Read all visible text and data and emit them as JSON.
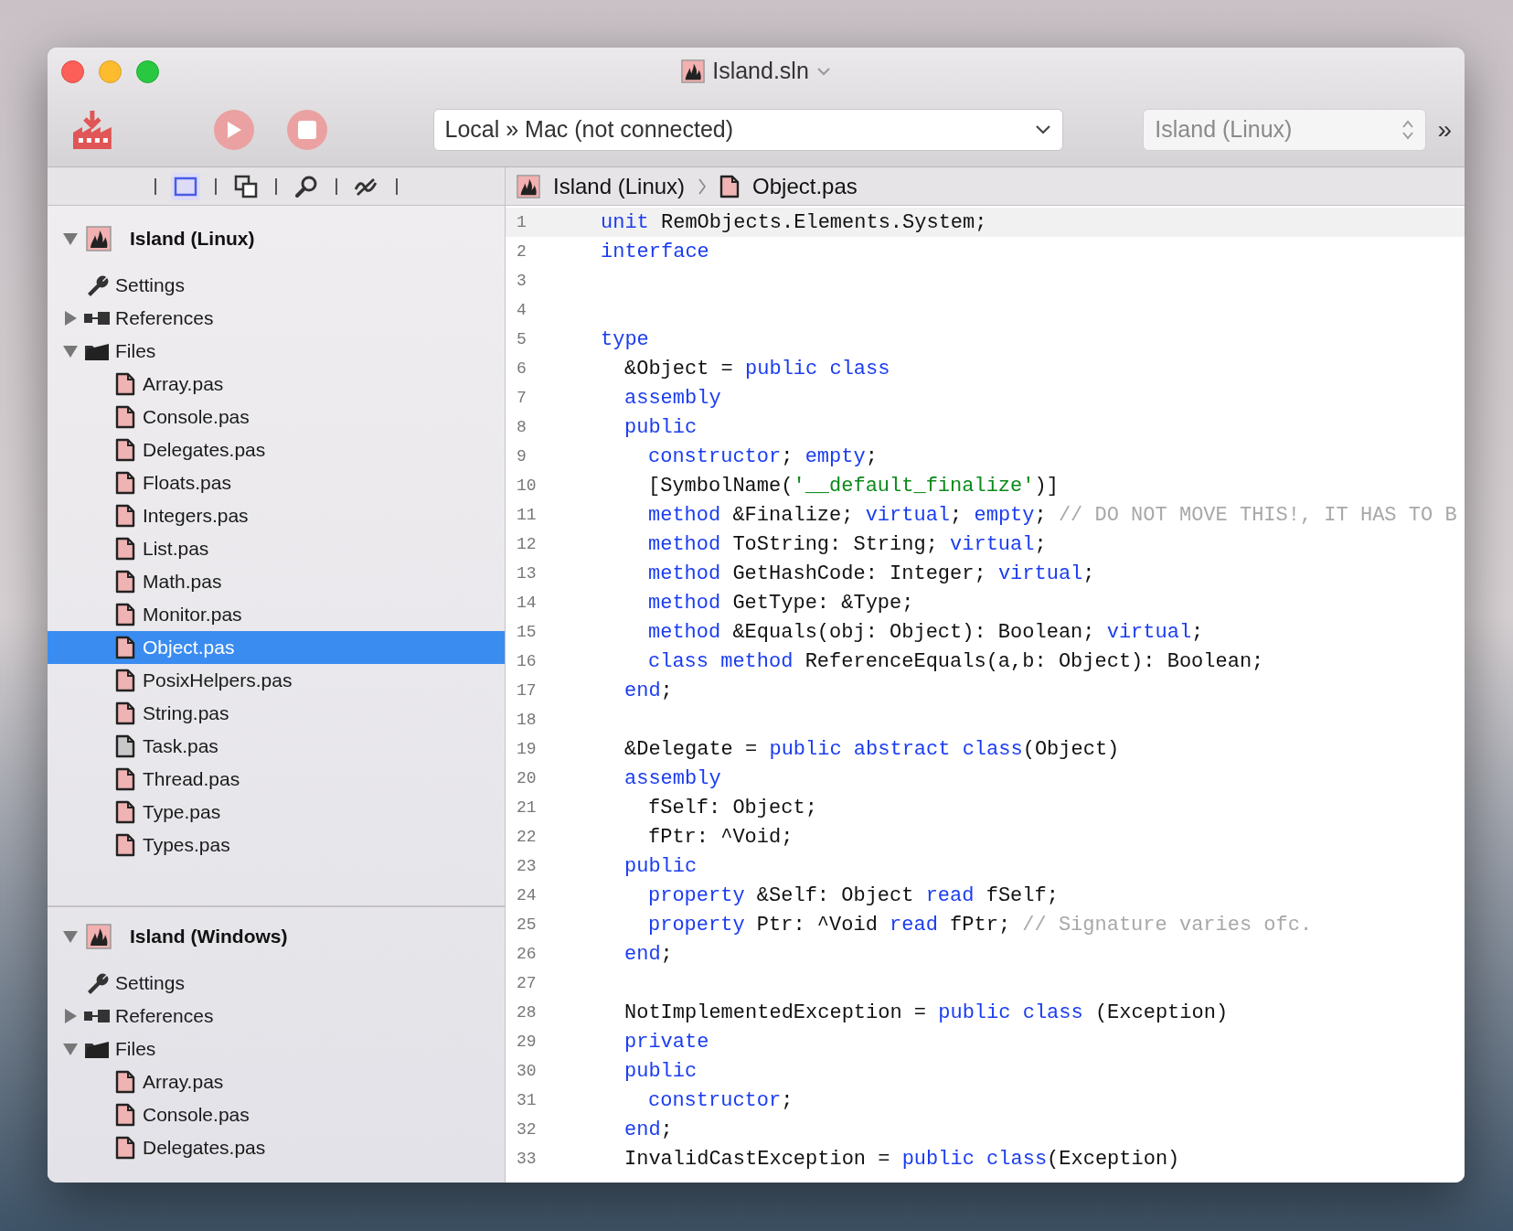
{
  "window": {
    "title": "Island.sln"
  },
  "toolbar": {
    "play_disabled": true,
    "stop_disabled": true,
    "device": "Local » Mac (not connected)",
    "target": "Island (Linux)",
    "overflow": "»"
  },
  "breadcrumb": [
    "Island (Linux)",
    "Object.pas"
  ],
  "sidebar": {
    "tabs": [
      {
        "kind": "project",
        "selected": true
      },
      {
        "kind": "copy",
        "selected": false
      },
      {
        "kind": "search",
        "selected": false
      },
      {
        "kind": "diff",
        "selected": false
      }
    ],
    "projects": [
      {
        "name": "Island (Linux)",
        "expanded": true,
        "items": [
          {
            "kind": "settings",
            "label": "Settings",
            "selected": false
          },
          {
            "kind": "references",
            "label": "References",
            "expanded": false,
            "selected": false
          },
          {
            "kind": "folder",
            "label": "Files",
            "expanded": true,
            "selected": false,
            "children": [
              {
                "kind": "file",
                "label": "Array.pas",
                "color": "#efb3b3",
                "selected": false
              },
              {
                "kind": "file",
                "label": "Console.pas",
                "color": "#efb3b3",
                "selected": false
              },
              {
                "kind": "file",
                "label": "Delegates.pas",
                "color": "#efb3b3",
                "selected": false
              },
              {
                "kind": "file",
                "label": "Floats.pas",
                "color": "#efb3b3",
                "selected": false
              },
              {
                "kind": "file",
                "label": "Integers.pas",
                "color": "#efb3b3",
                "selected": false
              },
              {
                "kind": "file",
                "label": "List.pas",
                "color": "#efb3b3",
                "selected": false
              },
              {
                "kind": "file",
                "label": "Math.pas",
                "color": "#efb3b3",
                "selected": false
              },
              {
                "kind": "file",
                "label": "Monitor.pas",
                "color": "#efb3b3",
                "selected": false
              },
              {
                "kind": "file",
                "label": "Object.pas",
                "color": "#efb3b3",
                "selected": true
              },
              {
                "kind": "file",
                "label": "PosixHelpers.pas",
                "color": "#efb3b3",
                "selected": false
              },
              {
                "kind": "file",
                "label": "String.pas",
                "color": "#efb3b3",
                "selected": false
              },
              {
                "kind": "file",
                "label": "Task.pas",
                "color": "#c8c8c8",
                "selected": false
              },
              {
                "kind": "file",
                "label": "Thread.pas",
                "color": "#efb3b3",
                "selected": false
              },
              {
                "kind": "file",
                "label": "Type.pas",
                "color": "#efb3b3",
                "selected": false
              },
              {
                "kind": "file",
                "label": "Types.pas",
                "color": "#efb3b3",
                "selected": false
              }
            ]
          }
        ]
      },
      {
        "name": "Island (Windows)",
        "expanded": true,
        "items": [
          {
            "kind": "settings",
            "label": "Settings",
            "selected": false
          },
          {
            "kind": "references",
            "label": "References",
            "expanded": false,
            "selected": false
          },
          {
            "kind": "folder",
            "label": "Files",
            "expanded": true,
            "selected": false,
            "children": [
              {
                "kind": "file",
                "label": "Array.pas",
                "color": "#efb3b3",
                "selected": false
              },
              {
                "kind": "file",
                "label": "Console.pas",
                "color": "#efb3b3",
                "selected": false
              },
              {
                "kind": "file",
                "label": "Delegates.pas",
                "color": "#efb3b3",
                "selected": false
              }
            ]
          }
        ]
      }
    ]
  },
  "editor": {
    "lines": [
      {
        "number": "1",
        "current": true,
        "kind": "section",
        "tokens": [
          {
            "kind": "keyword",
            "text": "unit"
          },
          {
            "kind": "plain",
            "text": " RemObjects.Elements.System;"
          }
        ]
      },
      {
        "number": "2",
        "current": false,
        "kind": "section",
        "tokens": [
          {
            "kind": "keyword",
            "text": "interface"
          }
        ]
      },
      {
        "number": "3",
        "current": false,
        "kind": "blank"
      },
      {
        "number": "4",
        "current": false,
        "kind": "blank"
      },
      {
        "number": "5",
        "current": false,
        "kind": "section",
        "tokens": [
          {
            "kind": "keyword",
            "text": "type"
          }
        ]
      },
      {
        "number": "6",
        "current": false,
        "kind": "declaration",
        "tokens": [
          {
            "kind": "plain",
            "text": "&Object = "
          },
          {
            "kind": "keyword",
            "text": "public class"
          }
        ]
      },
      {
        "number": "7",
        "current": false,
        "kind": "declaration",
        "tokens": [
          {
            "kind": "keyword",
            "text": "assembly"
          }
        ]
      },
      {
        "number": "8",
        "current": false,
        "kind": "declaration",
        "tokens": [
          {
            "kind": "keyword",
            "text": "public"
          }
        ]
      },
      {
        "number": "9",
        "current": false,
        "kind": "member",
        "tokens": [
          {
            "kind": "keyword",
            "text": "constructor"
          },
          {
            "kind": "plain",
            "text": "; "
          },
          {
            "kind": "keyword",
            "text": "empty"
          },
          {
            "kind": "plain",
            "text": ";"
          }
        ]
      },
      {
        "number": "10",
        "current": false,
        "kind": "member",
        "tokens": [
          {
            "kind": "plain",
            "text": "[SymbolName("
          },
          {
            "kind": "string",
            "text": "'__default_finalize'"
          },
          {
            "kind": "plain",
            "text": ")]"
          }
        ]
      },
      {
        "number": "11",
        "current": false,
        "kind": "member",
        "tokens": [
          {
            "kind": "keyword",
            "text": "method"
          },
          {
            "kind": "plain",
            "text": " &Finalize; "
          },
          {
            "kind": "keyword",
            "text": "virtual"
          },
          {
            "kind": "plain",
            "text": "; "
          },
          {
            "kind": "keyword",
            "text": "empty"
          },
          {
            "kind": "plain",
            "text": "; "
          },
          {
            "kind": "comment",
            "text": "// DO NOT MOVE THIS!, IT HAS TO B"
          }
        ]
      },
      {
        "number": "12",
        "current": false,
        "kind": "member",
        "tokens": [
          {
            "kind": "keyword",
            "text": "method"
          },
          {
            "kind": "plain",
            "text": " ToString: String; "
          },
          {
            "kind": "keyword",
            "text": "virtual"
          },
          {
            "kind": "plain",
            "text": ";"
          }
        ]
      },
      {
        "number": "13",
        "current": false,
        "kind": "member",
        "tokens": [
          {
            "kind": "keyword",
            "text": "method"
          },
          {
            "kind": "plain",
            "text": " GetHashCode: Integer; "
          },
          {
            "kind": "keyword",
            "text": "virtual"
          },
          {
            "kind": "plain",
            "text": ";"
          }
        ]
      },
      {
        "number": "14",
        "current": false,
        "kind": "member",
        "tokens": [
          {
            "kind": "keyword",
            "text": "method"
          },
          {
            "kind": "plain",
            "text": " GetType: &Type;"
          }
        ]
      },
      {
        "number": "15",
        "current": false,
        "kind": "member",
        "tokens": [
          {
            "kind": "keyword",
            "text": "method"
          },
          {
            "kind": "plain",
            "text": " &Equals(obj: Object): Boolean; "
          },
          {
            "kind": "keyword",
            "text": "virtual"
          },
          {
            "kind": "plain",
            "text": ";"
          }
        ]
      },
      {
        "number": "16",
        "current": false,
        "kind": "member",
        "tokens": [
          {
            "kind": "keyword",
            "text": "class method"
          },
          {
            "kind": "plain",
            "text": " ReferenceEquals(a,b: Object): Boolean;"
          }
        ]
      },
      {
        "number": "17",
        "current": false,
        "kind": "declaration",
        "tokens": [
          {
            "kind": "keyword",
            "text": "end"
          },
          {
            "kind": "plain",
            "text": ";"
          }
        ]
      },
      {
        "number": "18",
        "current": false,
        "kind": "blank"
      },
      {
        "number": "19",
        "current": false,
        "kind": "declaration",
        "tokens": [
          {
            "kind": "plain",
            "text": "&Delegate = "
          },
          {
            "kind": "keyword",
            "text": "public abstract class"
          },
          {
            "kind": "plain",
            "text": "(Object)"
          }
        ]
      },
      {
        "number": "20",
        "current": false,
        "kind": "declaration",
        "tokens": [
          {
            "kind": "keyword",
            "text": "assembly"
          }
        ]
      },
      {
        "number": "21",
        "current": false,
        "kind": "member",
        "tokens": [
          {
            "kind": "plain",
            "text": "fSelf: Object;"
          }
        ]
      },
      {
        "number": "22",
        "current": false,
        "kind": "member",
        "tokens": [
          {
            "kind": "plain",
            "text": "fPtr: ^Void;"
          }
        ]
      },
      {
        "number": "23",
        "current": false,
        "kind": "declaration",
        "tokens": [
          {
            "kind": "keyword",
            "text": "public"
          }
        ]
      },
      {
        "number": "24",
        "current": false,
        "kind": "member",
        "tokens": [
          {
            "kind": "keyword",
            "text": "property"
          },
          {
            "kind": "plain",
            "text": " &Self: Object "
          },
          {
            "kind": "keyword",
            "text": "read"
          },
          {
            "kind": "plain",
            "text": " fSelf;"
          }
        ]
      },
      {
        "number": "25",
        "current": false,
        "kind": "member",
        "tokens": [
          {
            "kind": "keyword",
            "text": "property"
          },
          {
            "kind": "plain",
            "text": " Ptr: ^Void "
          },
          {
            "kind": "keyword",
            "text": "read"
          },
          {
            "kind": "plain",
            "text": " fPtr; "
          },
          {
            "kind": "comment",
            "text": "// Signature varies ofc."
          }
        ]
      },
      {
        "number": "26",
        "current": false,
        "kind": "declaration",
        "tokens": [
          {
            "kind": "keyword",
            "text": "end"
          },
          {
            "kind": "plain",
            "text": ";"
          }
        ]
      },
      {
        "number": "27",
        "current": false,
        "kind": "blank"
      },
      {
        "number": "28",
        "current": false,
        "kind": "declaration",
        "tokens": [
          {
            "kind": "plain",
            "text": "NotImplementedException = "
          },
          {
            "kind": "keyword",
            "text": "public class"
          },
          {
            "kind": "plain",
            "text": " (Exception)"
          }
        ]
      },
      {
        "number": "29",
        "current": false,
        "kind": "declaration",
        "tokens": [
          {
            "kind": "keyword",
            "text": "private"
          }
        ]
      },
      {
        "number": "30",
        "current": false,
        "kind": "declaration",
        "tokens": [
          {
            "kind": "keyword",
            "text": "public"
          }
        ]
      },
      {
        "number": "31",
        "current": false,
        "kind": "member",
        "tokens": [
          {
            "kind": "keyword",
            "text": "constructor"
          },
          {
            "kind": "plain",
            "text": ";"
          }
        ]
      },
      {
        "number": "32",
        "current": false,
        "kind": "declaration",
        "tokens": [
          {
            "kind": "keyword",
            "text": "end"
          },
          {
            "kind": "plain",
            "text": ";"
          }
        ]
      },
      {
        "number": "33",
        "current": false,
        "kind": "declaration",
        "tokens": [
          {
            "kind": "plain",
            "text": "InvalidCastException = "
          },
          {
            "kind": "keyword",
            "text": "public class"
          },
          {
            "kind": "plain",
            "text": "(Exception)"
          }
        ]
      }
    ]
  }
}
